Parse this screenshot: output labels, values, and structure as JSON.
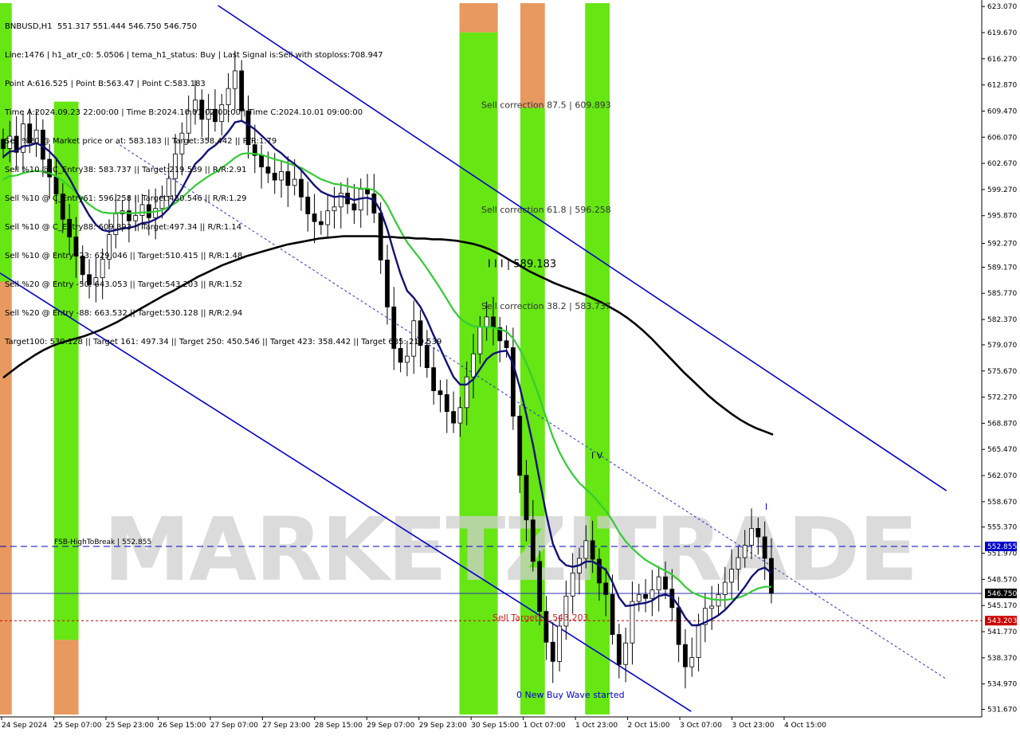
{
  "symbol_header": "BNBUSD,H1  551.317 551.444 546.750 546.750",
  "info_lines": [
    "Line:1476 | h1_atr_c0: 5.0506 | tema_h1_status: Buy | Last Signal is:Sell with stoploss:708.947",
    "Point A:616.525 | Point B:563.47 | Point C:583.183",
    "Time A:2024.09.23 22:00:00 | Time B:2024.10.01 02:00:00 | Time C:2024.10.01 09:00:00",
    "Sell %20 @ Market price or at: 583.183 || Target:358.442 || R/R:1.79",
    "Sell %10 @ C_Entry38: 583.737 || Target:219.539 || R/R:2.91",
    "Sell %10 @ C_Entry61: 596.258 || Target:450.546 || R/R:1.29",
    "Sell %10 @ C_Entry88: 609.893 || Target:497.34 || R/R:1.14",
    "Sell %10 @ Entry -23: 629.046 || Target:510.415 || R/R:1.48",
    "Sell %20 @ Entry -50: 643.053 || Target:543.203 || R/R:1.52",
    "Sell %20 @ Entry -88: 663.532 || Target:530.128 || R/R:2.94",
    "Target100: 530.128 || Target 161: 497.34 || Target 250: 450.546 || Target 423: 358.442 || Target 685: 219.539"
  ],
  "watermark": "MARKETZITRADE",
  "price_axis": {
    "ticks": [
      "623.070",
      "619.670",
      "616.270",
      "612.870",
      "609.470",
      "606.070",
      "602.670",
      "599.270",
      "595.870",
      "592.270",
      "589.170",
      "585.770",
      "582.370",
      "579.070",
      "575.670",
      "572.270",
      "568.870",
      "565.470",
      "562.070",
      "558.670",
      "555.370",
      "551.970",
      "548.570",
      "545.170",
      "541.770",
      "538.370",
      "534.970",
      "531.670"
    ],
    "tick_values": [
      623.07,
      619.67,
      616.27,
      612.87,
      609.47,
      606.07,
      602.67,
      599.27,
      595.87,
      592.27,
      589.17,
      585.77,
      582.37,
      579.07,
      575.67,
      572.27,
      568.87,
      565.47,
      562.07,
      558.67,
      555.37,
      551.97,
      548.57,
      545.17,
      541.77,
      538.37,
      534.97,
      531.67
    ],
    "min": 531.0,
    "max": 623.5
  },
  "time_axis": {
    "labels": [
      "24 Sep 2024",
      "25 Sep 07:00",
      "25 Sep 23:00",
      "26 Sep 15:00",
      "27 Sep 07:00",
      "27 Sep 23:00",
      "28 Sep 15:00",
      "29 Sep 07:00",
      "29 Sep 23:00",
      "30 Sep 15:00",
      "1 Oct 07:00",
      "1 Oct 23:00",
      "2 Oct 15:00",
      "3 Oct 07:00",
      "3 Oct 23:00",
      "4 Oct 15:00"
    ]
  },
  "price_tags": [
    {
      "label": "552.855",
      "value": 552.855,
      "bg": "#0000cc",
      "fg": "#ffffff"
    },
    {
      "label": "546.750",
      "value": 546.75,
      "bg": "#000000",
      "fg": "#ffffff"
    },
    {
      "label": "543.203",
      "value": 543.203,
      "bg": "#cc0000",
      "fg": "#ffffff"
    }
  ],
  "levels": [
    {
      "label": "FSB-HighToBreak | 552.855",
      "value": 552.855,
      "color": "#0000cc",
      "style": "dashed"
    },
    {
      "label": "",
      "value": 546.75,
      "color": "#3333bb",
      "style": "solid"
    },
    {
      "label": "",
      "value": 543.203,
      "color": "#cc0000",
      "style": "dotted"
    }
  ],
  "annotations": [
    {
      "text": "Sell correction 87.5 | 609.893",
      "value": 609.893,
      "color": "#333333"
    },
    {
      "text": "Sell correction 61.8 | 596.258",
      "value": 596.258,
      "color": "#333333"
    },
    {
      "text": "Sell correction 38.2 | 583.737",
      "value": 583.737,
      "color": "#333333"
    },
    {
      "text": "I I I | 589.183",
      "value": 589.183,
      "color": "#000000"
    },
    {
      "text": "I V",
      "value": 564.3,
      "color": "#000000"
    },
    {
      "text": "Sell Target1 | 543.203",
      "value": 543.203,
      "color": "#cc2222"
    },
    {
      "text": "0 New Buy Wave started",
      "value": 533.2,
      "color": "#0000cc"
    },
    {
      "text": "I",
      "value": 557.6,
      "color": "#0000cc"
    }
  ],
  "chart_data": {
    "type": "candlestick",
    "title": "BNBUSD,H1",
    "ylim": [
      531.0,
      623.5
    ],
    "close": [
      604.6,
      606.2,
      604.1,
      607.8,
      605.3,
      607.0,
      603.2,
      600.9,
      598.7,
      595.4,
      593.1,
      590.6,
      588.2,
      586.9,
      587.8,
      590.2,
      593.4,
      596.1,
      596.5,
      595.2,
      595.9,
      597.3,
      595.6,
      596.8,
      598.4,
      600.7,
      603.9,
      606.6,
      609.5,
      610.9,
      608.4,
      609.7,
      608.1,
      610.3,
      612.4,
      614.7,
      609.5,
      605.1,
      603.7,
      602.2,
      601.4,
      600.5,
      601.6,
      599.8,
      600.6,
      598.3,
      596.1,
      595.1,
      594.7,
      596.5,
      597.0,
      598.8,
      597.4,
      596.6,
      599.3,
      598.7,
      596.2,
      590.1,
      584.0,
      578.6,
      576.8,
      577.6,
      582.2,
      579.0,
      576.1,
      573.1,
      572.6,
      570.4,
      568.9,
      570.9,
      574.9,
      577.9,
      581.4,
      582.7,
      581.3,
      579.6,
      578.7,
      569.8,
      562.1,
      556.3,
      550.9,
      544.4,
      540.4,
      537.9,
      542.5,
      546.4,
      549.4,
      551.3,
      553.6,
      551.2,
      548.1,
      546.6,
      541.4,
      537.5,
      540.3,
      545.7,
      546.6,
      546.1,
      547.2,
      548.9,
      547.3,
      544.9,
      540.1,
      537.2,
      538.4,
      542.7,
      544.8,
      545.1,
      546.6,
      548.2,
      549.9,
      551.4,
      553.0,
      555.2,
      554.1,
      551.3,
      546.75
    ],
    "ema_short": [
      603.5,
      604.2,
      604.3,
      604.9,
      605.0,
      605.3,
      604.9,
      604.2,
      603.3,
      602.1,
      600.7,
      599.1,
      597.4,
      595.9,
      594.7,
      594.0,
      593.8,
      594.0,
      594.2,
      594.3,
      594.5,
      594.9,
      595.0,
      595.4,
      595.9,
      596.8,
      598.0,
      599.4,
      601.0,
      602.6,
      603.4,
      604.4,
      605.0,
      605.8,
      606.8,
      608.0,
      608.2,
      607.7,
      607.1,
      606.3,
      605.5,
      604.6,
      604.0,
      603.2,
      602.6,
      601.8,
      600.8,
      599.8,
      599.0,
      598.6,
      598.3,
      598.4,
      598.2,
      597.9,
      598.1,
      598.2,
      597.9,
      596.5,
      594.1,
      591.1,
      588.3,
      586.1,
      585.2,
      584.0,
      582.3,
      580.3,
      578.6,
      576.7,
      574.9,
      573.9,
      573.9,
      574.6,
      575.9,
      577.2,
      577.9,
      578.2,
      578.3,
      576.6,
      573.6,
      570.0,
      566.1,
      561.5,
      557.1,
      553.2,
      551.2,
      550.4,
      550.2,
      550.4,
      550.9,
      550.9,
      550.4,
      549.8,
      548.2,
      546.2,
      545.1,
      545.2,
      545.4,
      545.5,
      545.8,
      546.4,
      546.6,
      546.3,
      545.1,
      543.6,
      542.6,
      542.6,
      543.0,
      543.4,
      543.9,
      544.6,
      545.5,
      546.5,
      547.6,
      548.9,
      549.8,
      550.1,
      549.4
    ],
    "ema_mid": [
      600.6,
      601.0,
      601.1,
      601.4,
      601.6,
      601.7,
      601.6,
      601.4,
      601.0,
      600.4,
      599.7,
      598.9,
      598.1,
      597.3,
      596.7,
      596.3,
      596.2,
      596.2,
      596.3,
      596.2,
      596.2,
      596.3,
      596.3,
      596.4,
      596.6,
      597.0,
      597.5,
      598.2,
      599.0,
      599.8,
      600.4,
      601.0,
      601.5,
      602.1,
      602.7,
      603.4,
      603.9,
      604.0,
      603.9,
      603.8,
      603.5,
      603.2,
      603.0,
      602.7,
      602.4,
      602.1,
      601.6,
      601.1,
      600.6,
      600.3,
      600.0,
      599.9,
      599.7,
      599.5,
      599.4,
      599.4,
      599.2,
      598.5,
      597.2,
      595.5,
      593.9,
      592.4,
      591.3,
      590.2,
      589.0,
      587.7,
      586.4,
      585.0,
      583.6,
      582.5,
      581.9,
      581.5,
      581.4,
      581.4,
      581.3,
      581.1,
      580.8,
      579.9,
      578.5,
      576.7,
      574.6,
      572.2,
      569.6,
      567.1,
      565.1,
      563.5,
      562.2,
      561.1,
      560.3,
      559.5,
      558.5,
      557.5,
      556.2,
      554.7,
      553.5,
      552.6,
      551.8,
      551.1,
      550.6,
      550.1,
      549.7,
      549.2,
      548.5,
      547.6,
      546.9,
      546.5,
      546.2,
      546.0,
      545.9,
      545.9,
      546.0,
      546.2,
      546.5,
      547.0,
      547.4,
      547.6,
      547.6
    ],
    "sma_long": [
      574.8,
      575.6,
      576.4,
      577.1,
      577.8,
      578.4,
      578.9,
      579.3,
      579.6,
      579.9,
      580.2,
      580.6,
      581.0,
      581.5,
      582.0,
      582.6,
      583.2,
      583.8,
      584.4,
      585.0,
      585.6,
      586.1,
      586.7,
      587.3,
      587.9,
      588.4,
      588.9,
      589.4,
      589.8,
      590.2,
      590.6,
      590.9,
      591.2,
      591.5,
      591.8,
      592.1,
      592.3,
      592.5,
      592.7,
      592.9,
      593.0,
      593.1,
      593.2,
      593.2,
      593.2,
      593.2,
      593.2,
      593.1,
      593.1,
      593.0,
      593.0,
      592.9,
      592.9,
      592.8,
      592.8,
      592.7,
      592.6,
      592.4,
      592.2,
      591.9,
      591.5,
      591.0,
      590.4,
      589.8,
      589.2,
      588.6,
      588.1,
      587.6,
      587.1,
      586.7,
      586.3,
      585.9,
      585.5,
      585.0,
      584.5,
      583.9,
      583.3,
      582.6,
      581.8,
      580.9,
      579.9,
      578.8,
      577.7,
      576.6,
      575.5,
      574.5,
      573.5,
      572.5,
      571.6,
      570.8,
      570.0,
      569.3,
      568.7,
      568.2,
      567.8,
      567.4
    ],
    "channels": [
      {
        "name": "upper",
        "color": "#0000cc",
        "width": 1.6,
        "x1": 0.222,
        "y1": 623.2,
        "x2": 0.964,
        "y2": 560.1
      },
      {
        "name": "lower",
        "color": "#0000cc",
        "width": 1.6,
        "x1": 0.0,
        "y1": 588.4,
        "x2": 0.704,
        "y2": 531.4
      },
      {
        "name": "mid-dotted",
        "color": "#2233cc",
        "width": 1.0,
        "dash": "3,3",
        "x1": 0.118,
        "y1": 605.4,
        "x2": 0.964,
        "y2": 535.6
      }
    ],
    "zones": [
      {
        "name": "zone-1",
        "x": 0.0,
        "w": 0.012,
        "top": 623.5,
        "bottom": 587.3,
        "color": "#66e612"
      },
      {
        "name": "zone-1b",
        "x": 0.0,
        "w": 0.012,
        "top": 587.3,
        "bottom": 531.0,
        "color": "#e8995f"
      },
      {
        "name": "zone-2",
        "x": 0.055,
        "w": 0.025,
        "top": 610.7,
        "bottom": 540.7,
        "color": "#66e612"
      },
      {
        "name": "zone-2b",
        "x": 0.055,
        "w": 0.025,
        "top": 540.7,
        "bottom": 531.0,
        "color": "#e8995f"
      },
      {
        "name": "zone-3",
        "x": 0.468,
        "w": 0.039,
        "top": 623.5,
        "bottom": 619.7,
        "color": "#e8995f"
      },
      {
        "name": "zone-3b",
        "x": 0.468,
        "w": 0.039,
        "top": 619.7,
        "bottom": 531.0,
        "color": "#66e612"
      },
      {
        "name": "zone-4",
        "x": 0.53,
        "w": 0.025,
        "top": 623.5,
        "bottom": 609.9,
        "color": "#e8995f"
      },
      {
        "name": "zone-4b",
        "x": 0.53,
        "w": 0.025,
        "top": 609.9,
        "bottom": 531.0,
        "color": "#66e612"
      },
      {
        "name": "zone-5",
        "x": 0.596,
        "w": 0.025,
        "top": 623.5,
        "bottom": 531.0,
        "color": "#66e612"
      }
    ]
  }
}
